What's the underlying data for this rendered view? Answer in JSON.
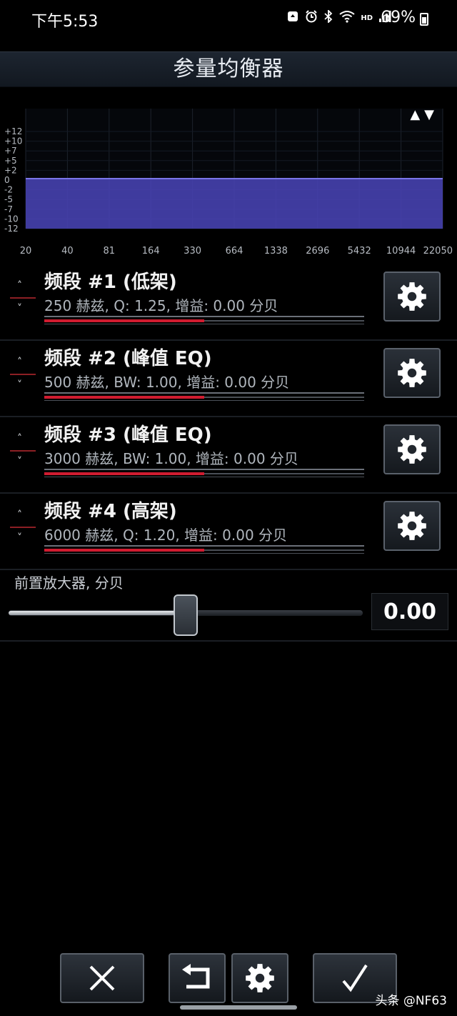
{
  "status_bar": {
    "time": "下午5:53",
    "icons": [
      "notification-icon",
      "alarm-icon",
      "bluetooth-icon",
      "wifi-icon",
      "hd-label",
      "signal-icon"
    ],
    "hd_label": "HD",
    "battery": "69%"
  },
  "title": "参量均衡器",
  "graph": {
    "y_labels": [
      "+12",
      "+10",
      "+7",
      "+5",
      "+2",
      "0",
      "-2",
      "-5",
      "-7",
      "-10",
      "-12"
    ],
    "x_labels": [
      "20",
      "40",
      "81",
      "164",
      "330",
      "664",
      "1338",
      "2696",
      "5432",
      "10944",
      "22050"
    ],
    "arrows": "▲▼",
    "fill_color": "#4a44b8"
  },
  "bands": [
    {
      "title": "频段 #1 (低架)",
      "detail": "250 赫兹, Q: 1.25, 增益: 0.00 分贝",
      "level": 0.5
    },
    {
      "title": "频段 #2 (峰值 EQ)",
      "detail": "500 赫兹, BW: 1.00, 增益: 0.00 分贝",
      "level": 0.5
    },
    {
      "title": "频段 #3 (峰值 EQ)",
      "detail": "3000 赫兹, BW: 1.00, 增益: 0.00 分贝",
      "level": 0.5
    },
    {
      "title": "频段 #4 (高架)",
      "detail": "6000 赫兹, Q: 1.20, 增益: 0.00 分贝",
      "level": 0.5
    }
  ],
  "preamp": {
    "label": "前置放大器, 分贝",
    "value": "0.00",
    "level": 0.5
  },
  "watermark": "头条 @NF63",
  "colors": {
    "accent_red": "#d01c30",
    "graph_fill": "#4a44b8",
    "background": "#000000"
  }
}
